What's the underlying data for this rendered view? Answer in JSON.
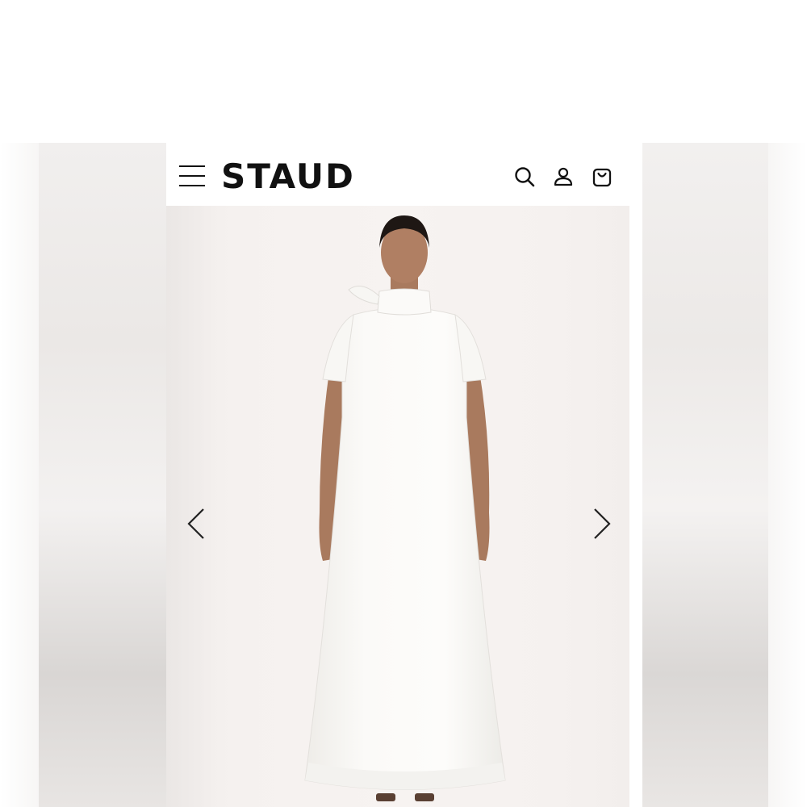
{
  "header": {
    "brand": "STAUD",
    "menu_icon": "hamburger-menu-icon",
    "icons": [
      "search-icon",
      "account-icon",
      "cart-icon"
    ]
  },
  "hero": {
    "prev_icon": "chevron-left-icon",
    "next_icon": "chevron-right-icon",
    "image": "model-in-white-maxi-dress"
  },
  "colors": {
    "brand_text": "#111111",
    "background": "#f5f1ef",
    "dress": "#fbfaf8",
    "skin": "#b07f63"
  }
}
